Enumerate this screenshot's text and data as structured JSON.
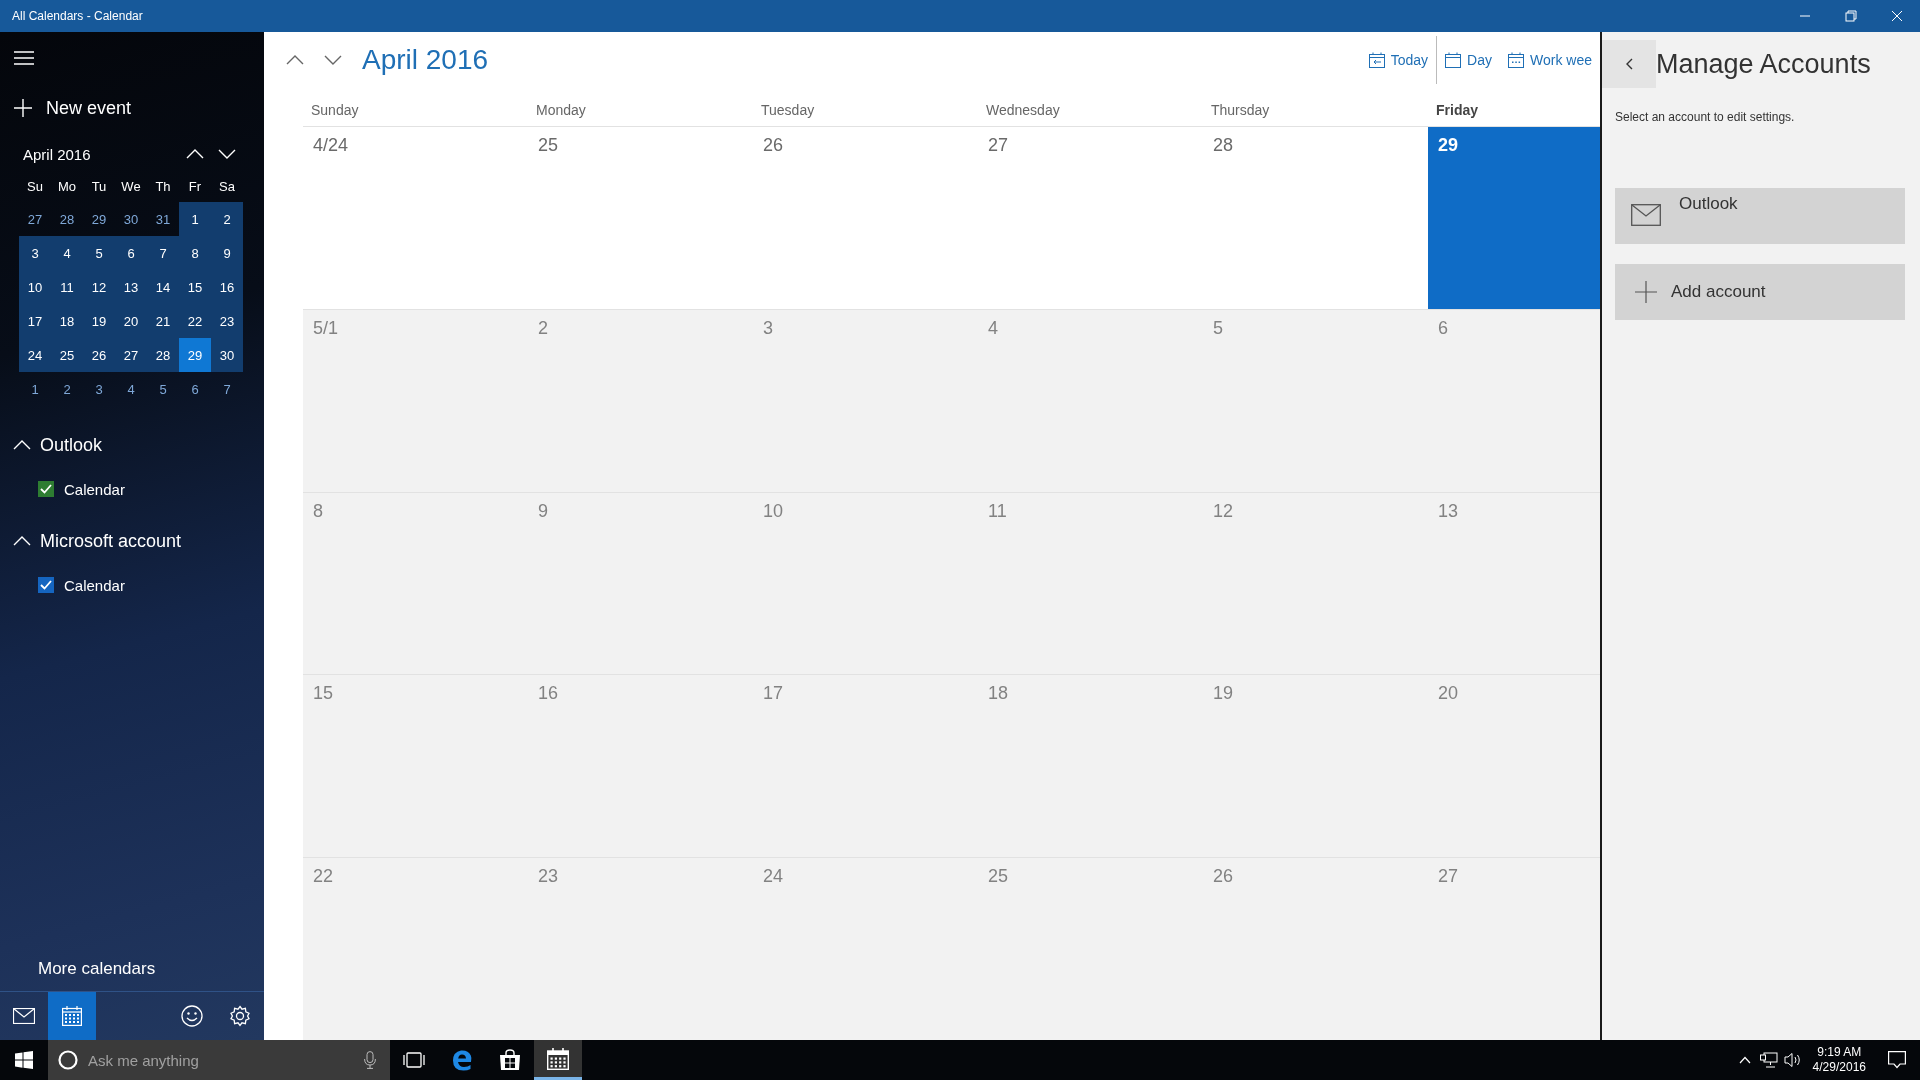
{
  "window": {
    "title": "All Calendars - Calendar"
  },
  "sidebar": {
    "new_event": "New event",
    "mini_calendar": {
      "title": "April 2016",
      "weekdays": [
        "Su",
        "Mo",
        "Tu",
        "We",
        "Th",
        "Fr",
        "Sa"
      ],
      "weeks": [
        {
          "days": [
            {
              "day": "27",
              "in_month": false,
              "selected": false
            },
            {
              "day": "28",
              "in_month": false,
              "selected": false
            },
            {
              "day": "29",
              "in_month": false,
              "selected": false
            },
            {
              "day": "30",
              "in_month": false,
              "selected": false
            },
            {
              "day": "31",
              "in_month": false,
              "selected": false
            },
            {
              "day": "1",
              "in_month": true,
              "selected": false
            },
            {
              "day": "2",
              "in_month": true,
              "selected": false
            }
          ]
        },
        {
          "days": [
            {
              "day": "3",
              "in_month": true,
              "selected": false
            },
            {
              "day": "4",
              "in_month": true,
              "selected": false
            },
            {
              "day": "5",
              "in_month": true,
              "selected": false
            },
            {
              "day": "6",
              "in_month": true,
              "selected": false
            },
            {
              "day": "7",
              "in_month": true,
              "selected": false
            },
            {
              "day": "8",
              "in_month": true,
              "selected": false
            },
            {
              "day": "9",
              "in_month": true,
              "selected": false
            }
          ]
        },
        {
          "days": [
            {
              "day": "10",
              "in_month": true,
              "selected": false
            },
            {
              "day": "11",
              "in_month": true,
              "selected": false
            },
            {
              "day": "12",
              "in_month": true,
              "selected": false
            },
            {
              "day": "13",
              "in_month": true,
              "selected": false
            },
            {
              "day": "14",
              "in_month": true,
              "selected": false
            },
            {
              "day": "15",
              "in_month": true,
              "selected": false
            },
            {
              "day": "16",
              "in_month": true,
              "selected": false
            }
          ]
        },
        {
          "days": [
            {
              "day": "17",
              "in_month": true,
              "selected": false
            },
            {
              "day": "18",
              "in_month": true,
              "selected": false
            },
            {
              "day": "19",
              "in_month": true,
              "selected": false
            },
            {
              "day": "20",
              "in_month": true,
              "selected": false
            },
            {
              "day": "21",
              "in_month": true,
              "selected": false
            },
            {
              "day": "22",
              "in_month": true,
              "selected": false
            },
            {
              "day": "23",
              "in_month": true,
              "selected": false
            }
          ]
        },
        {
          "days": [
            {
              "day": "24",
              "in_month": true,
              "selected": false
            },
            {
              "day": "25",
              "in_month": true,
              "selected": false
            },
            {
              "day": "26",
              "in_month": true,
              "selected": false
            },
            {
              "day": "27",
              "in_month": true,
              "selected": false
            },
            {
              "day": "28",
              "in_month": true,
              "selected": false
            },
            {
              "day": "29",
              "in_month": true,
              "selected": true
            },
            {
              "day": "30",
              "in_month": true,
              "selected": false
            }
          ]
        },
        {
          "days": [
            {
              "day": "1",
              "in_month": false,
              "selected": false
            },
            {
              "day": "2",
              "in_month": false,
              "selected": false
            },
            {
              "day": "3",
              "in_month": false,
              "selected": false
            },
            {
              "day": "4",
              "in_month": false,
              "selected": false
            },
            {
              "day": "5",
              "in_month": false,
              "selected": false
            },
            {
              "day": "6",
              "in_month": false,
              "selected": false
            },
            {
              "day": "7",
              "in_month": false,
              "selected": false
            }
          ]
        }
      ]
    },
    "groups": [
      {
        "name": "Outlook",
        "expanded": true,
        "calendars": [
          {
            "name": "Calendar",
            "checked": true,
            "color": "#2e7d32"
          }
        ]
      },
      {
        "name": "Microsoft account",
        "expanded": true,
        "calendars": [
          {
            "name": "Calendar",
            "checked": true,
            "color": "#1565c0"
          }
        ]
      }
    ],
    "more_calendars": "More calendars",
    "nav": [
      {
        "kind": "mail",
        "selected": false
      },
      {
        "kind": "calendar",
        "selected": true
      },
      {
        "kind": "feedback",
        "selected": false
      },
      {
        "kind": "settings",
        "selected": false
      }
    ]
  },
  "main": {
    "title": "April 2016",
    "views": [
      {
        "kind": "today",
        "label": "Today"
      },
      {
        "kind": "day",
        "label": "Day"
      },
      {
        "kind": "workweek",
        "label": "Work wee"
      }
    ],
    "weekdays": [
      {
        "label": "Sunday",
        "today": false
      },
      {
        "label": "Monday",
        "today": false
      },
      {
        "label": "Tuesday",
        "today": false
      },
      {
        "label": "Wednesday",
        "today": false
      },
      {
        "label": "Thursday",
        "today": false
      },
      {
        "label": "Friday",
        "today": true
      }
    ],
    "weeks": [
      {
        "days": [
          {
            "label": "4/24",
            "in_month": true,
            "today": false
          },
          {
            "label": "25",
            "in_month": true,
            "today": false
          },
          {
            "label": "26",
            "in_month": true,
            "today": false
          },
          {
            "label": "27",
            "in_month": true,
            "today": false
          },
          {
            "label": "28",
            "in_month": true,
            "today": false
          },
          {
            "label": "29",
            "today": true
          }
        ]
      },
      {
        "days": [
          {
            "label": "5/1",
            "in_month": false,
            "today": false
          },
          {
            "label": "2",
            "in_month": false,
            "today": false
          },
          {
            "label": "3",
            "in_month": false,
            "today": false
          },
          {
            "label": "4",
            "in_month": false,
            "today": false
          },
          {
            "label": "5",
            "in_month": false,
            "today": false
          },
          {
            "label": "6",
            "in_month": false,
            "today": false
          }
        ]
      },
      {
        "days": [
          {
            "label": "8",
            "in_month": false,
            "today": false
          },
          {
            "label": "9",
            "in_month": false,
            "today": false
          },
          {
            "label": "10",
            "in_month": false,
            "today": false
          },
          {
            "label": "11",
            "in_month": false,
            "today": false
          },
          {
            "label": "12",
            "in_month": false,
            "today": false
          },
          {
            "label": "13",
            "in_month": false,
            "today": false
          }
        ]
      },
      {
        "days": [
          {
            "label": "15",
            "in_month": false,
            "today": false
          },
          {
            "label": "16",
            "in_month": false,
            "today": false
          },
          {
            "label": "17",
            "in_month": false,
            "today": false
          },
          {
            "label": "18",
            "in_month": false,
            "today": false
          },
          {
            "label": "19",
            "in_month": false,
            "today": false
          },
          {
            "label": "20",
            "in_month": false,
            "today": false
          }
        ]
      },
      {
        "days": [
          {
            "label": "22",
            "in_month": false,
            "today": false
          },
          {
            "label": "23",
            "in_month": false,
            "today": false
          },
          {
            "label": "24",
            "in_month": false,
            "today": false
          },
          {
            "label": "25",
            "in_month": false,
            "today": false
          },
          {
            "label": "26",
            "in_month": false,
            "today": false
          },
          {
            "label": "27",
            "in_month": false,
            "today": false
          }
        ]
      }
    ]
  },
  "accounts_panel": {
    "title": "Manage Accounts",
    "hint": "Select an account to edit settings.",
    "accounts": [
      {
        "kind": "account",
        "name": "Outlook"
      },
      {
        "kind": "add",
        "name": "Add account"
      }
    ]
  },
  "taskbar": {
    "search": {
      "placeholder": "Ask me anything"
    },
    "apps": [
      {
        "kind": "task-view",
        "active": false
      },
      {
        "kind": "edge",
        "active": false
      },
      {
        "kind": "store",
        "active": false
      },
      {
        "kind": "calendar",
        "active": true
      }
    ],
    "clock": {
      "time": "9:19 AM",
      "date": "4/29/2016"
    }
  }
}
